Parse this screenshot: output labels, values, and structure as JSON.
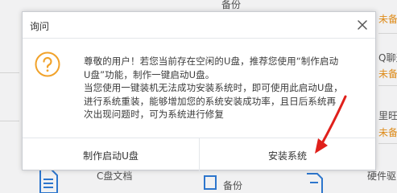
{
  "background": {
    "items": [
      {
        "id": "bg-backup-top",
        "text": "备份"
      },
      {
        "id": "bg-unbacked-1",
        "text": "未备"
      },
      {
        "id": "bg-qq-chat",
        "text": "Q聊天"
      },
      {
        "id": "bg-unbacked-2",
        "text": "未备"
      },
      {
        "id": "bg-aliwangwang",
        "text": "里旺旺"
      },
      {
        "id": "bg-unbacked-3",
        "text": "未备"
      },
      {
        "id": "bg-c-docs",
        "text": "C盘文档"
      },
      {
        "id": "bg-backup-bottom",
        "text": "备份"
      },
      {
        "id": "bg-hardware-driver",
        "text": "硬件驱"
      }
    ]
  },
  "dialog": {
    "title": "询问",
    "message": [
      "尊敬的用户！若您当前存在空闲的U盘，推荐您使用“制作启动",
      "U盘”功能，制作一键启动U盘。",
      "当您使用一键装机无法成功安装系统时，即可使用此启动U盘，",
      "进行系统重装，能够增加您的系统安装成功率，且日后系统再",
      "次出现问题时，可为系统进行修复"
    ],
    "buttons": {
      "make_usb": "制作启动U盘",
      "install_system": "安装系统"
    }
  },
  "colors": {
    "accent_orange": "#f1a22a",
    "annotation_red": "#e0201b"
  },
  "icons": [
    "question-icon",
    "close-icon",
    "folder-icon",
    "red-arrow-annotation"
  ]
}
